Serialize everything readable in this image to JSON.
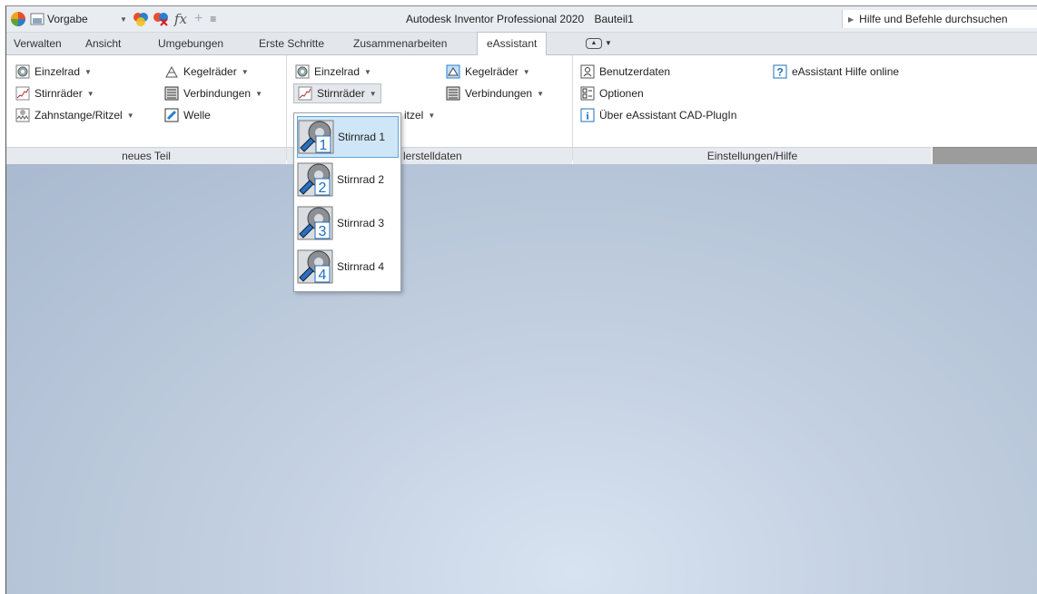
{
  "titlebar": {
    "style_name": "Vorgabe",
    "formula_label": "fx",
    "app_title": "Autodesk Inventor Professional 2020",
    "document_name": "Bauteil1",
    "help_search": "Hilfe und Befehle durchsuchen"
  },
  "tabs": [
    {
      "label": "Verwalten"
    },
    {
      "label": "Ansicht"
    },
    {
      "label": "Umgebungen"
    },
    {
      "label": "Erste Schritte"
    },
    {
      "label": "Zusammenarbeiten"
    },
    {
      "label": "eAssistant",
      "active": true
    }
  ],
  "ribbon": {
    "panel1": {
      "title": "neues Teil",
      "items": [
        {
          "label": "Einzelrad",
          "icon": "single-gear-icon",
          "dropdown": true
        },
        {
          "label": "Kegelräder",
          "icon": "bevel-gear-icon",
          "dropdown": true
        },
        {
          "label": "Stirnräder",
          "icon": "spur-gears-icon",
          "dropdown": true
        },
        {
          "label": "Verbindungen",
          "icon": "connections-icon",
          "dropdown": true
        },
        {
          "label": "Zahnstange/Ritzel",
          "icon": "rack-pinion-icon",
          "dropdown": true
        },
        {
          "label": "Welle",
          "icon": "shaft-icon",
          "dropdown": false
        }
      ]
    },
    "panel2": {
      "title_visible": "lerstelldaten",
      "items": [
        {
          "label": "Einzelrad",
          "icon": "single-gear-icon",
          "dropdown": true
        },
        {
          "label": "Kegelräder",
          "icon": "bevel-gear-icon",
          "dropdown": true
        },
        {
          "label": "Stirnräder",
          "icon": "spur-gears-icon",
          "dropdown": true,
          "pressed": true
        },
        {
          "label": "Verbindungen",
          "icon": "connections-icon",
          "dropdown": true
        },
        {
          "label_visible": "itzel",
          "dropdown": true
        }
      ]
    },
    "panel3": {
      "title": "Einstellungen/Hilfe",
      "items": [
        {
          "label": "Benutzerdaten",
          "icon": "user-data-icon"
        },
        {
          "label": "eAssistant Hilfe online",
          "icon": "help-icon"
        },
        {
          "label": "Optionen",
          "icon": "options-icon"
        },
        {
          "label": "Über eAssistant CAD-PlugIn",
          "icon": "info-icon"
        }
      ]
    }
  },
  "dropdown": {
    "items": [
      {
        "label": "Stirnrad 1",
        "number": "1",
        "selected": true
      },
      {
        "label": "Stirnrad 2",
        "number": "2"
      },
      {
        "label": "Stirnrad 3",
        "number": "3"
      },
      {
        "label": "Stirnrad 4",
        "number": "4"
      }
    ]
  },
  "colors": {
    "accent_blue": "#1f6fbf",
    "selection_bg": "#cfe6f7",
    "selection_border": "#5fa3d6",
    "viewport_light": "#d8e3f1",
    "viewport_dark": "#a9b9cf"
  }
}
